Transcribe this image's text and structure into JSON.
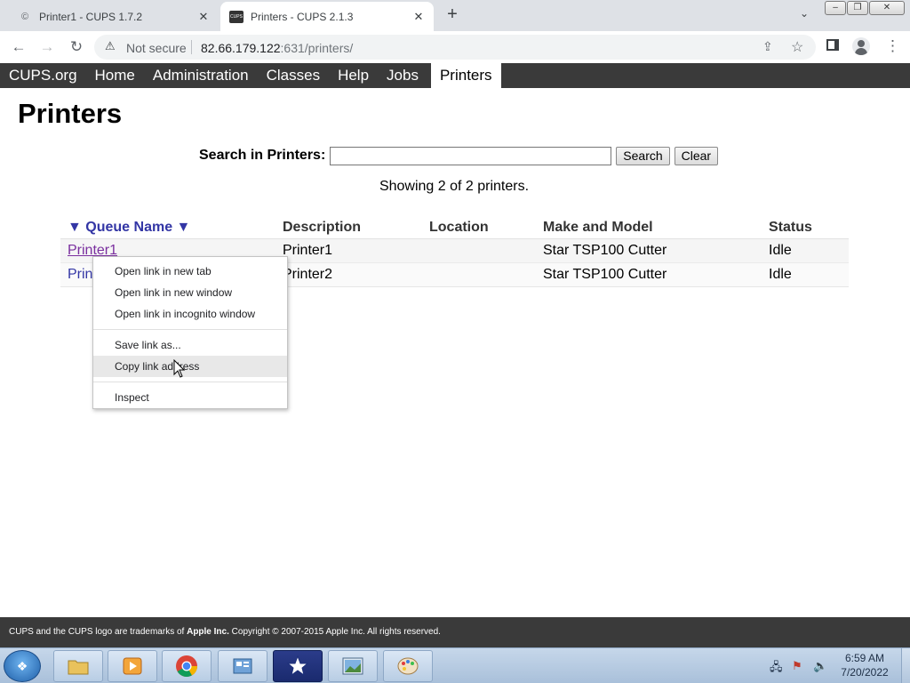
{
  "browser": {
    "tabs": [
      {
        "title": "Printer1 - CUPS 1.7.2"
      },
      {
        "title": "Printers - CUPS 2.1.3",
        "favicon_text": "CUPS"
      }
    ],
    "new_tab": "+",
    "omnibox": {
      "security_label": "Not secure",
      "url_host": "82.66.179.122",
      "url_rest": ":631/printers/"
    }
  },
  "cups_nav": {
    "items": [
      "CUPS.org",
      "Home",
      "Administration",
      "Classes",
      "Help",
      "Jobs",
      "Printers"
    ],
    "active": "Printers"
  },
  "page": {
    "title": "Printers",
    "search_label": "Search in Printers:",
    "search_value": "",
    "search_button": "Search",
    "clear_button": "Clear",
    "showing": "Showing 2 of 2 printers."
  },
  "table": {
    "headers": {
      "queue": "▼ Queue Name ▼",
      "description": "Description",
      "location": "Location",
      "make_model": "Make and Model",
      "status": "Status"
    },
    "rows": [
      {
        "queue": "Printer1",
        "description": "Printer1",
        "location": "",
        "make_model": "Star TSP100 Cutter",
        "status": "Idle"
      },
      {
        "queue": "Printer2",
        "description": "Printer2",
        "location": "",
        "make_model": "Star TSP100 Cutter",
        "status": "Idle"
      }
    ]
  },
  "context_menu": {
    "items": [
      "Open link in new tab",
      "Open link in new window",
      "Open link in incognito window",
      "Save link as...",
      "Copy link address",
      "Inspect"
    ],
    "hovered": "Copy link address"
  },
  "footer": {
    "prefix": "CUPS and the CUPS logo are trademarks of ",
    "company": "Apple Inc.",
    "suffix": " Copyright © 2007-2015 Apple Inc. All rights reserved."
  },
  "taskbar": {
    "time": "6:59 AM",
    "date": "7/20/2022"
  },
  "colors": {
    "cups_nav_bg": "#3a3a3a",
    "link": "#3336a5",
    "visited_link": "#7a2f9f"
  }
}
